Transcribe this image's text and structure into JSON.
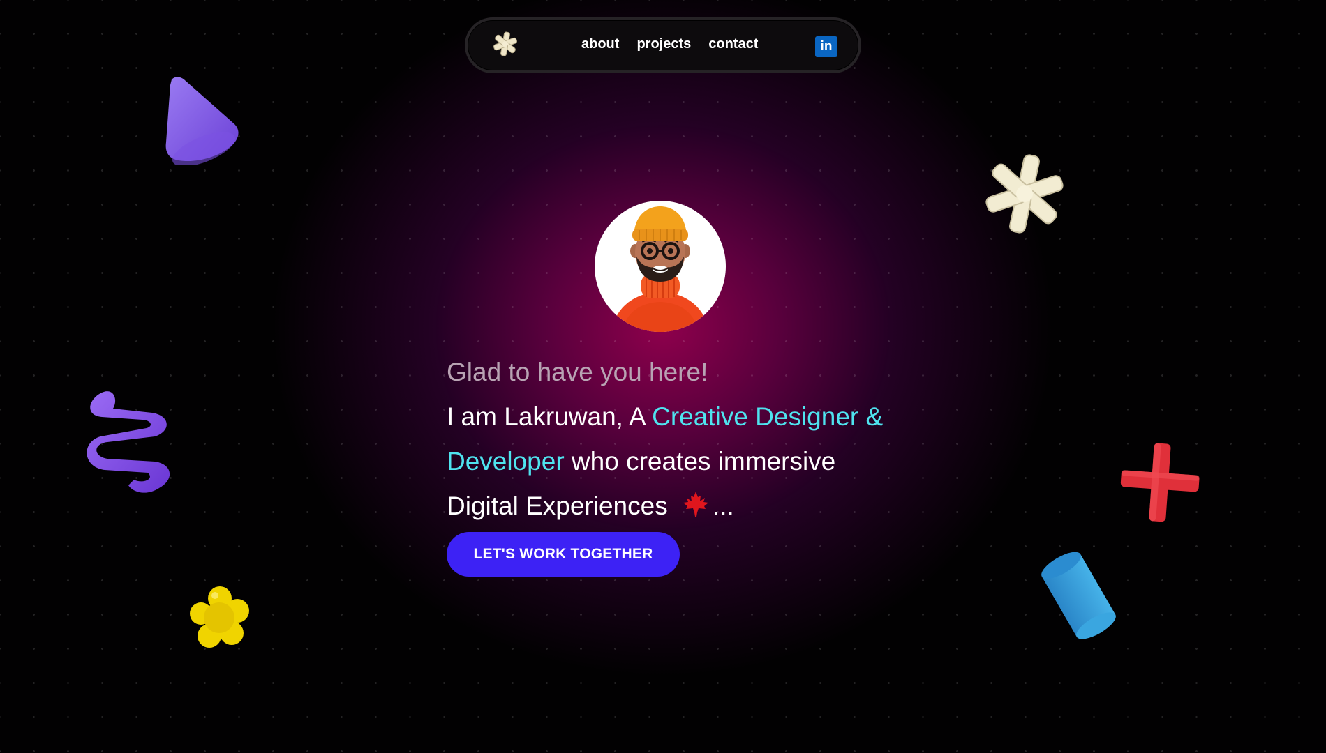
{
  "nav": {
    "logo_icon": "asterisk-flower-icon",
    "links": [
      "about",
      "projects",
      "contact"
    ],
    "linkedin_label": "in",
    "linkedin_icon": "linkedin-icon"
  },
  "hero": {
    "avatar_icon": "avatar-illustration",
    "greeting": "Glad to have you here!",
    "headline_part1": "I am Lakruwan, A ",
    "headline_accent": "Creative Designer & Developer",
    "headline_part2": " who creates immersive Digital Experiences",
    "headline_emoji": "maple-leaf-icon",
    "headline_ellipsis": "...",
    "cta_label": "LET'S WORK TOGETHER"
  },
  "colors": {
    "accent_text": "#4fe3ef",
    "cta_background": "#3d22f5",
    "glow": "#96004f",
    "linkedin": "#0a66c2"
  },
  "decorations": [
    "purple-cone-shape",
    "purple-spiral-shape",
    "yellow-flower-shape",
    "cream-asterisk-shape",
    "red-cross-shape",
    "blue-cylinder-shape"
  ]
}
